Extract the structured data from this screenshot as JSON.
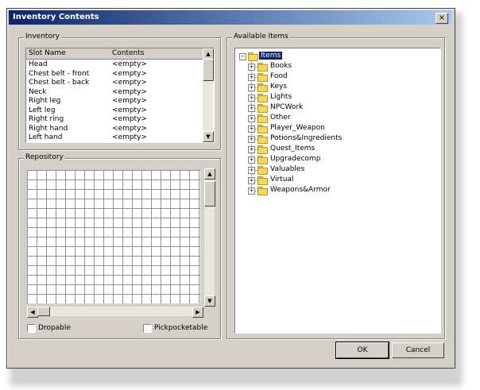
{
  "window": {
    "title": "Inventory Contents",
    "close_glyph": "×"
  },
  "inventory": {
    "legend": "Inventory",
    "columns": [
      "Slot Name",
      "Contents"
    ],
    "rows": [
      {
        "slot": "Head",
        "contents": "<empty>"
      },
      {
        "slot": "Chest belt - front",
        "contents": "<empty>"
      },
      {
        "slot": "Chest belt - back",
        "contents": "<empty>"
      },
      {
        "slot": "Neck",
        "contents": "<empty>"
      },
      {
        "slot": "Right leg",
        "contents": "<empty>"
      },
      {
        "slot": "Left leg",
        "contents": "<empty>"
      },
      {
        "slot": "Right ring",
        "contents": "<empty>"
      },
      {
        "slot": "Right hand",
        "contents": "<empty>"
      },
      {
        "slot": "Left hand",
        "contents": "<empty>"
      }
    ]
  },
  "repository": {
    "legend": "Repository",
    "dropable_label": "Dropable",
    "pickpocketable_label": "Pickpocketable"
  },
  "available": {
    "legend": "Available Items",
    "root": "Items",
    "children": [
      "Books",
      "Food",
      "Keys",
      "Lights",
      "NPCWork",
      "Other",
      "Player_Weapon",
      "Potions&Ingredients",
      "Quest_Items",
      "Upgradecomp",
      "Valuables",
      "Virtual",
      "Weapons&Armor"
    ]
  },
  "buttons": {
    "ok": "OK",
    "cancel": "Cancel"
  },
  "glyphs": {
    "up": "▲",
    "down": "▼",
    "left": "◀",
    "right": "▶",
    "minus": "−",
    "plus": "+"
  }
}
